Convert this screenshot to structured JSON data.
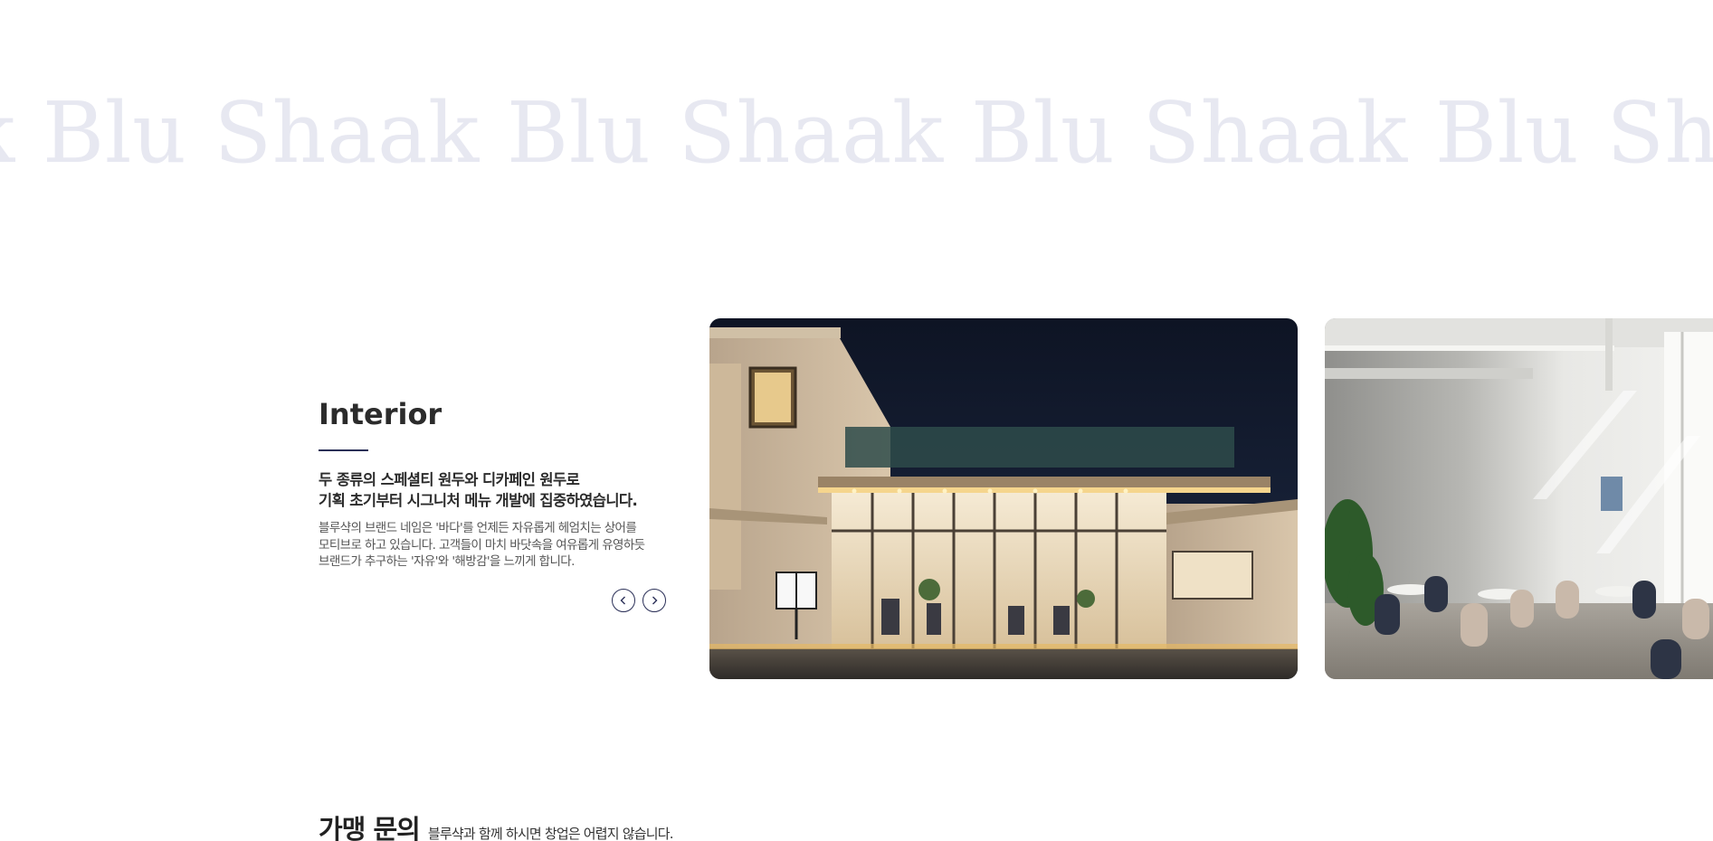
{
  "marquee": {
    "text": "k Blu Shaak Blu Shaak Blu Shaak Blu Shaak Blu ShaakBlu Shaak"
  },
  "interior": {
    "title": "Interior",
    "lead": "두 종류의 스페셜티 원두와 디카페인 원두로\n기획 초기부터 시그니처 메뉴 개발에 집중하였습니다.",
    "description": "블루샥의 브랜드 네임은 '바다'를 언제든 자유롭게 헤엄치는 상어를 모티브로 하고 있습니다. 고객들이 마치 바닷속을 여유롭게 유영하듯 브랜드가 추구하는 '자유'와 '해방감'을 느끼게 합니다."
  },
  "slider": {
    "prev_icon": "chevron-left-icon",
    "next_icon": "chevron-right-icon",
    "slides": [
      {
        "name": "storefront-night-photo"
      },
      {
        "name": "cafe-interior-seating-photo"
      }
    ]
  },
  "inquiry": {
    "title": "가맹 문의",
    "subtitle": "블루샥과 함께 하시면 창업은 어렵지 않습니다."
  },
  "colors": {
    "accent": "#2a2f57",
    "watermark": "#e7e8f1"
  }
}
